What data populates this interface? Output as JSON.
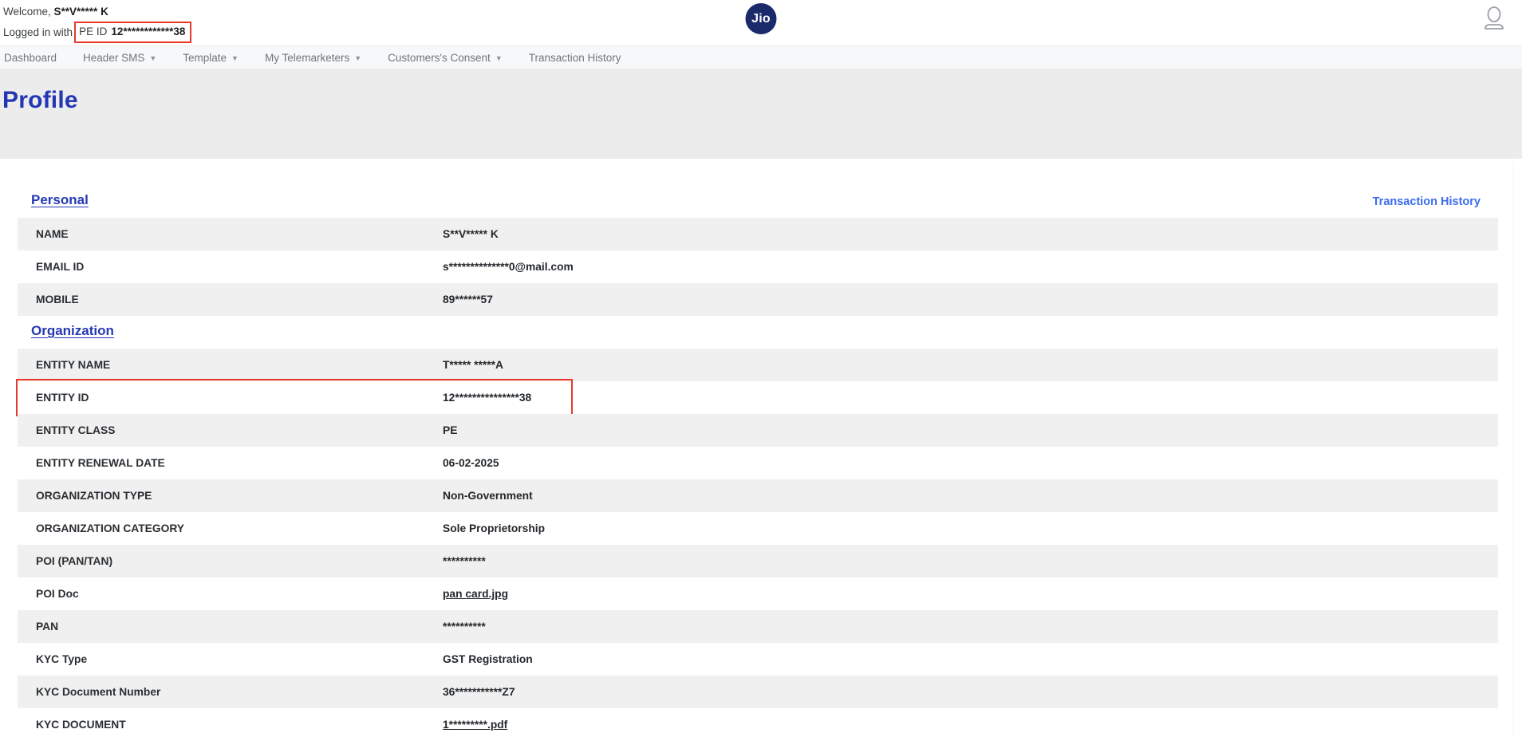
{
  "colors": {
    "accent_blue": "#2336b4",
    "link_blue": "#3b6cf0",
    "highlight_red": "#e8392b",
    "logo_navy": "#1b2a6b",
    "row_shade": "#f0f0f0"
  },
  "header": {
    "welcome_prefix": "Welcome, ",
    "welcome_name": "S**V***** K",
    "login_prefix": "Logged in with",
    "pe_id_label": "PE ID",
    "pe_id_value": "12************38",
    "logo_text": "Jio",
    "user_icon": "user-outline-icon"
  },
  "nav": {
    "caret_glyph": "▼",
    "items": [
      {
        "label": "Dashboard",
        "has_menu": false
      },
      {
        "label": "Header SMS",
        "has_menu": true
      },
      {
        "label": "Template",
        "has_menu": true
      },
      {
        "label": "My Telemarketers",
        "has_menu": true
      },
      {
        "label": "Customers's Consent",
        "has_menu": true
      },
      {
        "label": "Transaction History",
        "has_menu": false
      }
    ]
  },
  "page": {
    "title": "Profile",
    "transaction_history_link": "Transaction History"
  },
  "profile": {
    "sections": [
      {
        "heading": "Personal",
        "rows": [
          {
            "label": "NAME",
            "value": "S**V***** K"
          },
          {
            "label": "EMAIL ID",
            "value": "s**************0@mail.com"
          },
          {
            "label": "MOBILE",
            "value": "89******57"
          }
        ]
      },
      {
        "heading": "Organization",
        "rows": [
          {
            "label": "ENTITY NAME",
            "value": "T***** *****A"
          },
          {
            "label": "ENTITY ID",
            "value": "12***************38",
            "highlighted": true
          },
          {
            "label": "ENTITY CLASS",
            "value": "PE"
          },
          {
            "label": "ENTITY RENEWAL DATE",
            "value": "06-02-2025"
          },
          {
            "label": "ORGANIZATION TYPE",
            "value": "Non-Government"
          },
          {
            "label": "ORGANIZATION CATEGORY",
            "value": "Sole Proprietorship"
          },
          {
            "label": "POI (PAN/TAN)",
            "value": "**********"
          },
          {
            "label": "POI Doc",
            "value": "pan card.jpg",
            "link": true
          },
          {
            "label": "PAN",
            "value": "**********"
          },
          {
            "label": "KYC Type",
            "value": "GST Registration"
          },
          {
            "label": "KYC Document Number",
            "value": "36***********Z7"
          },
          {
            "label": "KYC DOCUMENT",
            "value": "1*********.pdf",
            "link": true
          }
        ]
      }
    ]
  }
}
